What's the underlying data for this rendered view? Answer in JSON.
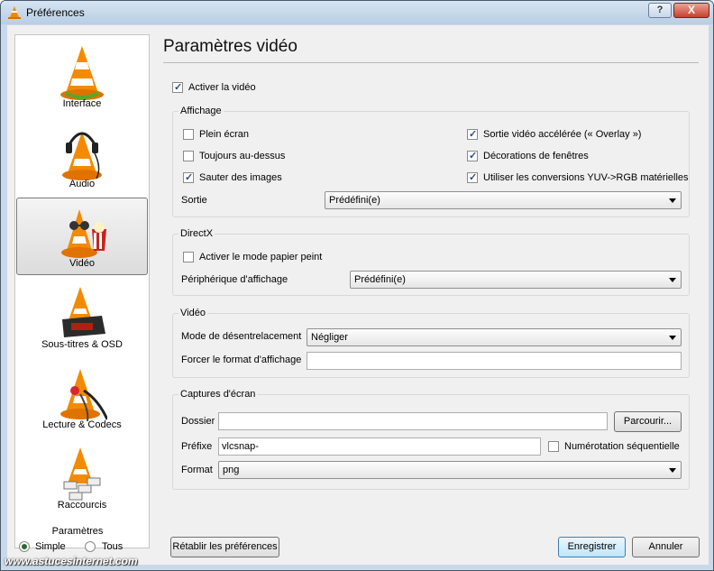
{
  "window": {
    "title": "Préférences",
    "help_label": "?",
    "close_label": "X"
  },
  "sidebar": {
    "items": [
      {
        "label": "Interface"
      },
      {
        "label": "Audio"
      },
      {
        "label": "Vidéo"
      },
      {
        "label": "Sous-titres & OSD"
      },
      {
        "label": "Lecture & Codecs"
      },
      {
        "label": "Raccourcis"
      }
    ],
    "selected": "Vidéo",
    "mode": {
      "title": "Paramètres",
      "simple": "Simple",
      "all": "Tous",
      "selected": "Simple"
    }
  },
  "main": {
    "heading": "Paramètres vidéo",
    "enable_video": {
      "label": "Activer la vidéo",
      "checked": true
    },
    "display": {
      "title": "Affichage",
      "fullscreen": {
        "label": "Plein écran",
        "checked": false
      },
      "on_top": {
        "label": "Toujours au-dessus",
        "checked": false
      },
      "skip_frames": {
        "label": "Sauter des images",
        "checked": true
      },
      "overlay": {
        "label": "Sortie vidéo accélérée (« Overlay »)",
        "checked": true
      },
      "decorations": {
        "label": "Décorations de fenêtres",
        "checked": true
      },
      "yuv": {
        "label": "Utiliser les conversions YUV->RGB matérielles",
        "checked": true
      },
      "output_label": "Sortie",
      "output_value": "Prédéfini(e)"
    },
    "directx": {
      "title": "DirectX",
      "wallpaper": {
        "label": "Activer le mode papier peint",
        "checked": false
      },
      "device_label": "Périphérique d'affichage",
      "device_value": "Prédéfini(e)"
    },
    "video": {
      "title": "Vidéo",
      "deinterlace_label": "Mode de désentrelacement",
      "deinterlace_value": "Négliger",
      "aspect_label": "Forcer le format d'affichage",
      "aspect_value": ""
    },
    "snapshots": {
      "title": "Captures d'écran",
      "folder_label": "Dossier",
      "folder_value": "",
      "browse_label": "Parcourir...",
      "prefix_label": "Préfixe",
      "prefix_value": "vlcsnap-",
      "sequential": {
        "label": "Numérotation séquentielle",
        "checked": false
      },
      "format_label": "Format",
      "format_value": "png"
    }
  },
  "footer": {
    "reset_label": "Rétablir les préférences",
    "save_label": "Enregistrer",
    "cancel_label": "Annuler"
  },
  "watermark": "www.astucesinternet.com"
}
